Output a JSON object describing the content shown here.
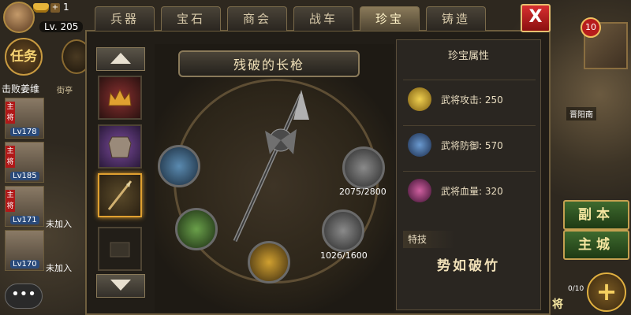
{
  "hud": {
    "resource_count": "1",
    "level": "Lv. 205",
    "task_label": "任务",
    "quest_text": "击败姜维",
    "quest_location": "街亭"
  },
  "heroes": [
    {
      "tag": "主将",
      "level": "Lv178"
    },
    {
      "tag": "主将",
      "level": "Lv185"
    },
    {
      "tag": "主将",
      "level": "Lv171",
      "note": "未加入"
    },
    {
      "tag": "",
      "level": "Lv170",
      "note": "未加入"
    }
  ],
  "right_hud": {
    "map_badge": "10",
    "city_label": "晋阳南",
    "dungeon_button": "副本",
    "main_city_button": "主城",
    "partial_label": "将",
    "partial_count": "0/10"
  },
  "tabs": [
    {
      "label": "兵器",
      "active": false
    },
    {
      "label": "宝石",
      "active": false
    },
    {
      "label": "商会",
      "active": false
    },
    {
      "label": "战车",
      "active": false
    },
    {
      "label": "珍宝",
      "active": true
    },
    {
      "label": "铸造",
      "active": false
    }
  ],
  "close_label": "X",
  "treasure": {
    "title": "残破的长枪",
    "gem_values": {
      "top_right": "2075/2800",
      "bottom_right": "1026/1600"
    }
  },
  "stats": {
    "header": "珍宝属性",
    "rows": [
      {
        "text": "武将攻击: 250",
        "icon": "attack-icon",
        "color": "#e0c040"
      },
      {
        "text": "武将防御: 570",
        "icon": "defense-shield-icon",
        "color": "#4a7ab0"
      },
      {
        "text": "武将血量: 320",
        "icon": "health-icon",
        "color": "#b04080"
      }
    ],
    "skill_header": "特技",
    "skill_name": "势如破竹"
  },
  "chat_icon": "chat-bubble-icon"
}
